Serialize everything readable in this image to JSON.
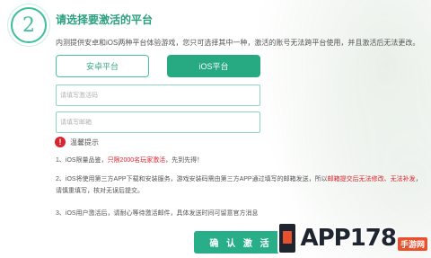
{
  "header": {
    "step_number": "2",
    "title": "请选择要激活的平台",
    "description": "内测提供安卓和iOS两种平台体验游戏，您只可选择其中一种，激活的账号无法跨平台使用，并且激活后无法更改。"
  },
  "platform_tabs": [
    {
      "label": "安卓平台",
      "selected": false
    },
    {
      "label": "iOS平台",
      "selected": true
    }
  ],
  "form": {
    "code_placeholder": "请填写激活码",
    "email_placeholder": "请填写邮箱"
  },
  "warning": {
    "title": "温馨提示",
    "note1_prefix": "1、iOS限量品鉴，",
    "note1_highlight": "只限2000名玩家激活",
    "note1_suffix": "，先到先得！",
    "note2_prefix": "2、iOS将使用第三方APP下载和安装服务，游戏安装码需由第三方APP通过填写的邮箱发送，所以",
    "note2_highlight": "邮箱提交后无法修改、无法补发",
    "note2_suffix": "，请慎重填写，核对无误后提交。",
    "note3": "3、iOS用户激活后，请耐心等待激活邮件，具体发送时间可留意官方消息"
  },
  "actions": {
    "confirm_label": "确 认 激 活"
  },
  "watermark": {
    "brand": "APP178",
    "sub": "手游网"
  },
  "colors": {
    "accent": "#27a982",
    "highlight_red": "#d9232e"
  }
}
